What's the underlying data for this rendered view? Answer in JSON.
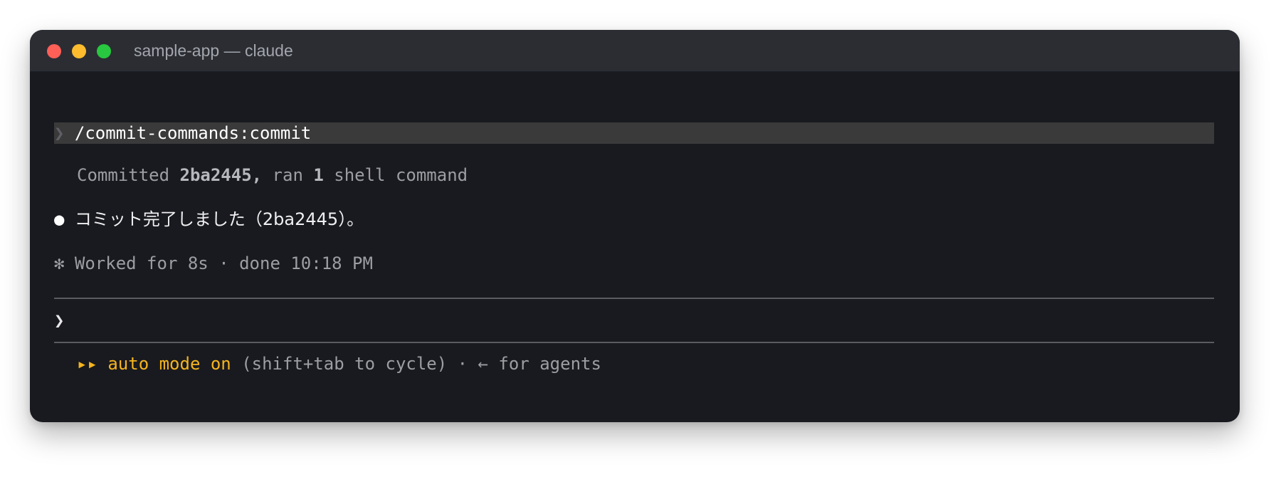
{
  "window": {
    "title": "sample-app — claude"
  },
  "terminal": {
    "command": {
      "prompt": "❯",
      "text": "/commit-commands:commit"
    },
    "result": {
      "prefix": "Committed ",
      "hash": "2ba2445,",
      "middle": " ran ",
      "count": "1",
      "suffix": " shell command"
    },
    "message": {
      "bullet": "●",
      "text": "コミット完了しました（2ba2445）。"
    },
    "status": {
      "symbol": "✻",
      "text": "Worked for 8s · done 10:18 PM"
    },
    "input": {
      "prompt": "❯",
      "value": ""
    },
    "footer": {
      "icon": "▸▸",
      "mode": "auto mode on",
      "hint": " (shift+tab to cycle) · ← for agents"
    }
  },
  "colors": {
    "window_bg": "#191a1f",
    "titlebar_bg": "#2b2d33",
    "accent_yellow": "#f5b41f",
    "traffic_red": "#fe5f57",
    "traffic_yellow": "#febc2e",
    "traffic_green": "#28c840"
  }
}
